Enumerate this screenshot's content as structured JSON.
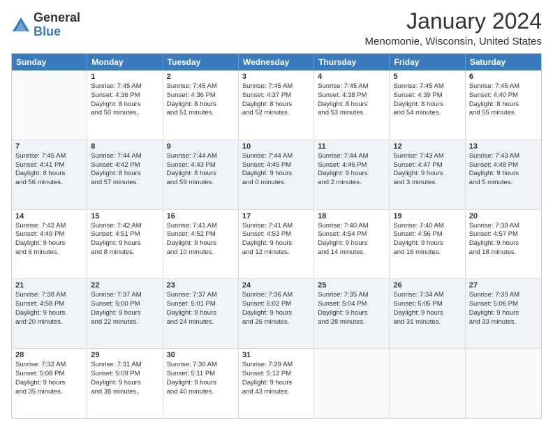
{
  "logo": {
    "general": "General",
    "blue": "Blue"
  },
  "title": "January 2024",
  "subtitle": "Menomonie, Wisconsin, United States",
  "headers": [
    "Sunday",
    "Monday",
    "Tuesday",
    "Wednesday",
    "Thursday",
    "Friday",
    "Saturday"
  ],
  "rows": [
    [
      {
        "day": "",
        "text": "",
        "empty": true
      },
      {
        "day": "1",
        "text": "Sunrise: 7:45 AM\nSunset: 4:36 PM\nDaylight: 8 hours\nand 50 minutes."
      },
      {
        "day": "2",
        "text": "Sunrise: 7:45 AM\nSunset: 4:36 PM\nDaylight: 8 hours\nand 51 minutes."
      },
      {
        "day": "3",
        "text": "Sunrise: 7:45 AM\nSunset: 4:37 PM\nDaylight: 8 hours\nand 52 minutes."
      },
      {
        "day": "4",
        "text": "Sunrise: 7:45 AM\nSunset: 4:38 PM\nDaylight: 8 hours\nand 53 minutes."
      },
      {
        "day": "5",
        "text": "Sunrise: 7:45 AM\nSunset: 4:39 PM\nDaylight: 8 hours\nand 54 minutes."
      },
      {
        "day": "6",
        "text": "Sunrise: 7:45 AM\nSunset: 4:40 PM\nDaylight: 8 hours\nand 55 minutes."
      }
    ],
    [
      {
        "day": "7",
        "text": "Sunrise: 7:45 AM\nSunset: 4:41 PM\nDaylight: 8 hours\nand 56 minutes."
      },
      {
        "day": "8",
        "text": "Sunrise: 7:44 AM\nSunset: 4:42 PM\nDaylight: 8 hours\nand 57 minutes."
      },
      {
        "day": "9",
        "text": "Sunrise: 7:44 AM\nSunset: 4:43 PM\nDaylight: 8 hours\nand 59 minutes."
      },
      {
        "day": "10",
        "text": "Sunrise: 7:44 AM\nSunset: 4:45 PM\nDaylight: 9 hours\nand 0 minutes."
      },
      {
        "day": "11",
        "text": "Sunrise: 7:44 AM\nSunset: 4:46 PM\nDaylight: 9 hours\nand 2 minutes."
      },
      {
        "day": "12",
        "text": "Sunrise: 7:43 AM\nSunset: 4:47 PM\nDaylight: 9 hours\nand 3 minutes."
      },
      {
        "day": "13",
        "text": "Sunrise: 7:43 AM\nSunset: 4:48 PM\nDaylight: 9 hours\nand 5 minutes."
      }
    ],
    [
      {
        "day": "14",
        "text": "Sunrise: 7:42 AM\nSunset: 4:49 PM\nDaylight: 9 hours\nand 6 minutes."
      },
      {
        "day": "15",
        "text": "Sunrise: 7:42 AM\nSunset: 4:51 PM\nDaylight: 9 hours\nand 8 minutes."
      },
      {
        "day": "16",
        "text": "Sunrise: 7:41 AM\nSunset: 4:52 PM\nDaylight: 9 hours\nand 10 minutes."
      },
      {
        "day": "17",
        "text": "Sunrise: 7:41 AM\nSunset: 4:53 PM\nDaylight: 9 hours\nand 12 minutes."
      },
      {
        "day": "18",
        "text": "Sunrise: 7:40 AM\nSunset: 4:54 PM\nDaylight: 9 hours\nand 14 minutes."
      },
      {
        "day": "19",
        "text": "Sunrise: 7:40 AM\nSunset: 4:56 PM\nDaylight: 9 hours\nand 16 minutes."
      },
      {
        "day": "20",
        "text": "Sunrise: 7:39 AM\nSunset: 4:57 PM\nDaylight: 9 hours\nand 18 minutes."
      }
    ],
    [
      {
        "day": "21",
        "text": "Sunrise: 7:38 AM\nSunset: 4:58 PM\nDaylight: 9 hours\nand 20 minutes."
      },
      {
        "day": "22",
        "text": "Sunrise: 7:37 AM\nSunset: 5:00 PM\nDaylight: 9 hours\nand 22 minutes."
      },
      {
        "day": "23",
        "text": "Sunrise: 7:37 AM\nSunset: 5:01 PM\nDaylight: 9 hours\nand 24 minutes."
      },
      {
        "day": "24",
        "text": "Sunrise: 7:36 AM\nSunset: 5:02 PM\nDaylight: 9 hours\nand 26 minutes."
      },
      {
        "day": "25",
        "text": "Sunrise: 7:35 AM\nSunset: 5:04 PM\nDaylight: 9 hours\nand 28 minutes."
      },
      {
        "day": "26",
        "text": "Sunrise: 7:34 AM\nSunset: 5:05 PM\nDaylight: 9 hours\nand 31 minutes."
      },
      {
        "day": "27",
        "text": "Sunrise: 7:33 AM\nSunset: 5:06 PM\nDaylight: 9 hours\nand 33 minutes."
      }
    ],
    [
      {
        "day": "28",
        "text": "Sunrise: 7:32 AM\nSunset: 5:08 PM\nDaylight: 9 hours\nand 35 minutes."
      },
      {
        "day": "29",
        "text": "Sunrise: 7:31 AM\nSunset: 5:09 PM\nDaylight: 9 hours\nand 38 minutes."
      },
      {
        "day": "30",
        "text": "Sunrise: 7:30 AM\nSunset: 5:11 PM\nDaylight: 9 hours\nand 40 minutes."
      },
      {
        "day": "31",
        "text": "Sunrise: 7:29 AM\nSunset: 5:12 PM\nDaylight: 9 hours\nand 43 minutes."
      },
      {
        "day": "",
        "text": "",
        "empty": true
      },
      {
        "day": "",
        "text": "",
        "empty": true
      },
      {
        "day": "",
        "text": "",
        "empty": true
      }
    ]
  ]
}
